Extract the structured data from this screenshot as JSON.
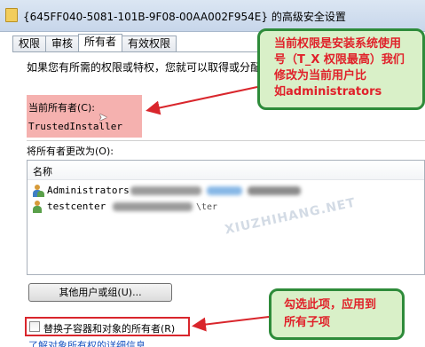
{
  "window": {
    "title": "{645FF040-5081-101B-9F08-00AA002F954E} 的高级安全设置"
  },
  "tabs": [
    {
      "label": "权限"
    },
    {
      "label": "审核"
    },
    {
      "label": "所有者"
    },
    {
      "label": "有效权限"
    }
  ],
  "owner_panel": {
    "intro": "如果您有所需的权限或特权，您就可以取得或分配",
    "current_owner_label": "当前所有者(C):",
    "current_owner_value": "TrustedInstaller",
    "change_owner_label": "将所有者更改为(O):",
    "name_column": "名称",
    "users": [
      {
        "name": "Administrators",
        "icon": "group-users-icon"
      },
      {
        "name": "testcenter",
        "icon": "user-icon",
        "detail": "\\ter"
      }
    ],
    "other_users_button": "其他用户或组(U)...",
    "replace_checkbox_label": "替换子容器和对象的所有者(R)",
    "replace_checked": false,
    "link": "了解对象所有权的详细信息"
  },
  "watermark": "XIUZHIHANG.NET",
  "annotations": {
    "callout_top": [
      "当前权限是安装系统使用",
      "号（T_X 权限最高）我们",
      "修改为当前用户比",
      "如administrators"
    ],
    "callout_bottom": [
      "勾选此项，应用到",
      "所有子项"
    ],
    "colors": {
      "callout_text": "#e0212a",
      "callout_bg": "#d9f0c8",
      "callout_border": "#2e8b3a",
      "highlight": "#f4a9a6",
      "arrow": "#d9262c"
    }
  }
}
